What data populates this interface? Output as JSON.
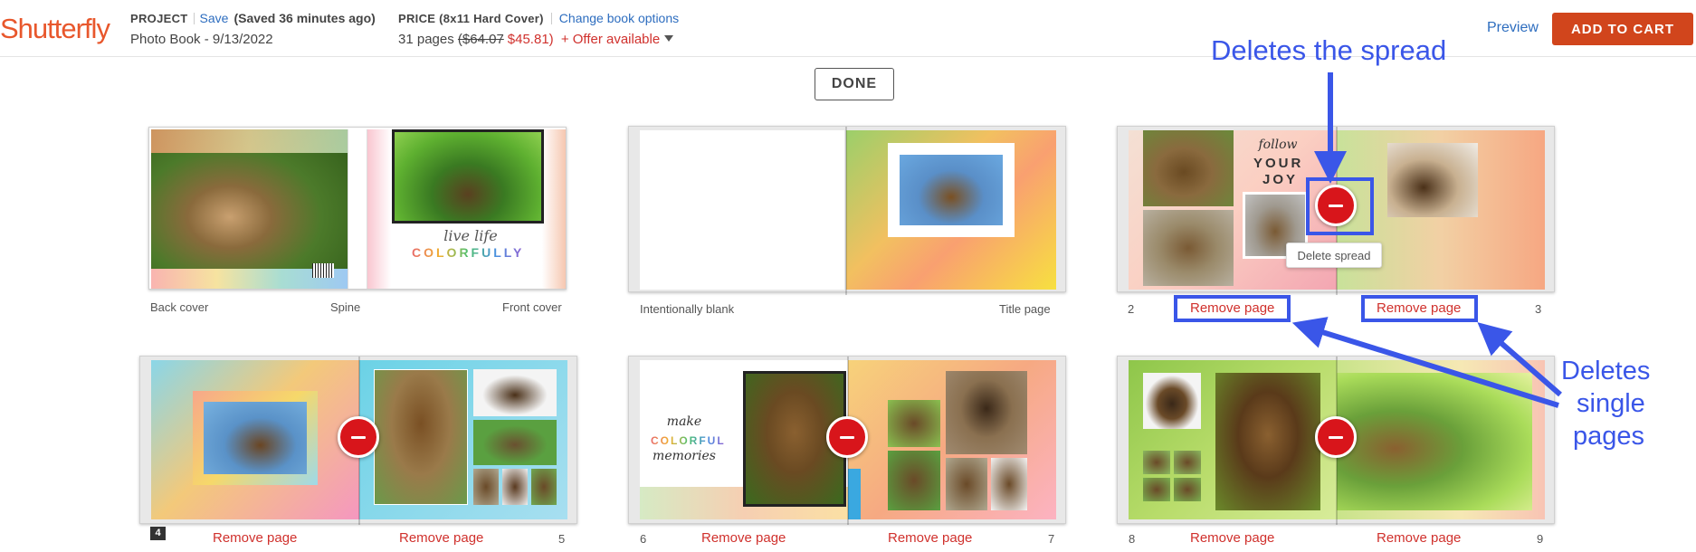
{
  "header": {
    "logo": "Shutterfly",
    "project_label": "PROJECT",
    "save_label": "Save",
    "saved_status": "(Saved 36 minutes ago)",
    "project_name": "Photo Book - 9/13/2022",
    "price_label": "PRICE (8x11 Hard Cover)",
    "change_options": "Change book options",
    "pages": "31 pages",
    "old_price": "($64.07",
    "new_price": "$45.81)",
    "offer": "+ Offer available",
    "preview": "Preview",
    "add_to_cart": "ADD TO CART"
  },
  "done_label": "DONE",
  "spreads": {
    "cover": {
      "left": "Back cover",
      "middle": "Spine",
      "right": "Front cover",
      "tagline": "live life",
      "colorful": "COLORFULLY"
    },
    "title": {
      "left": "Intentionally blank",
      "right": "Title page"
    },
    "s23": {
      "left_num": "2",
      "right_num": "3",
      "remove_left": "Remove page",
      "remove_right": "Remove page",
      "follow": "follow",
      "your": "YOUR",
      "joy": "JOY"
    },
    "s45": {
      "left_num": "4",
      "right_num": "5",
      "remove_left": "Remove page",
      "remove_right": "Remove page"
    },
    "s67": {
      "left_num": "6",
      "right_num": "7",
      "remove_left": "Remove page",
      "remove_right": "Remove page",
      "make": "make",
      "colorful": "COLORFUL",
      "memories": "memories"
    },
    "s89": {
      "left_num": "8",
      "right_num": "9",
      "remove_left": "Remove page",
      "remove_right": "Remove page"
    }
  },
  "tooltip": "Delete spread",
  "annotations": {
    "spread": "Deletes the spread",
    "pages_line1": "Deletes",
    "pages_line2": "single",
    "pages_line3": "pages"
  },
  "colors": {
    "accent": "#d1451c",
    "link": "#2d6dbf",
    "remove": "#d0312d",
    "annotation": "#3a56e8",
    "delete_button": "#d8151b"
  }
}
